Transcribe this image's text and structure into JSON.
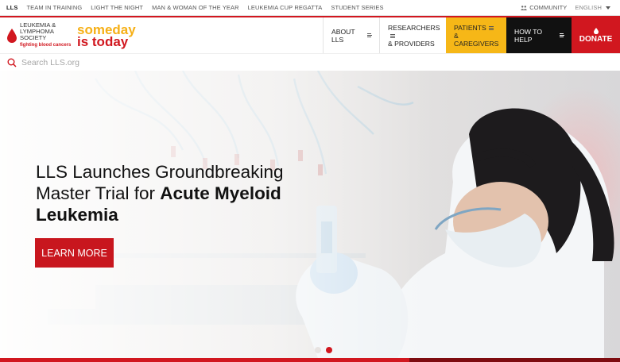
{
  "topbar": {
    "links": [
      "LLS",
      "TEAM IN TRAINING",
      "LIGHT THE NIGHT",
      "MAN & WOMAN OF THE YEAR",
      "LEUKEMIA CUP REGATTA",
      "STUDENT SERIES"
    ],
    "community": "COMMUNITY",
    "language": "ENGLISH"
  },
  "logo": {
    "org_line1": "LEUKEMIA &",
    "org_line2": "LYMPHOMA",
    "org_line3": "SOCIETY",
    "tagline": "fighting blood cancers",
    "someday_l1": "someday",
    "someday_l2": "is today"
  },
  "nav": {
    "about": "ABOUT LLS",
    "research_l1": "RESEARCHERS",
    "research_l2": "& PROVIDERS",
    "patients_l1": "PATIENTS",
    "patients_l2": "& CAREGIVERS",
    "help": "HOW TO HELP",
    "donate": "DONATE"
  },
  "search": {
    "placeholder": "Search LLS.org"
  },
  "hero": {
    "headline_part1": "LLS Launches Groundbreaking Master Trial for ",
    "headline_bold": "Acute Myeloid Leukemia",
    "cta": "LEARN MORE",
    "active_slide": 2,
    "slide_count": 2
  },
  "slider_progress": 0.66,
  "colors": {
    "brand_red": "#d1171f",
    "brand_yellow": "#f6b717",
    "help_black": "#111111"
  }
}
